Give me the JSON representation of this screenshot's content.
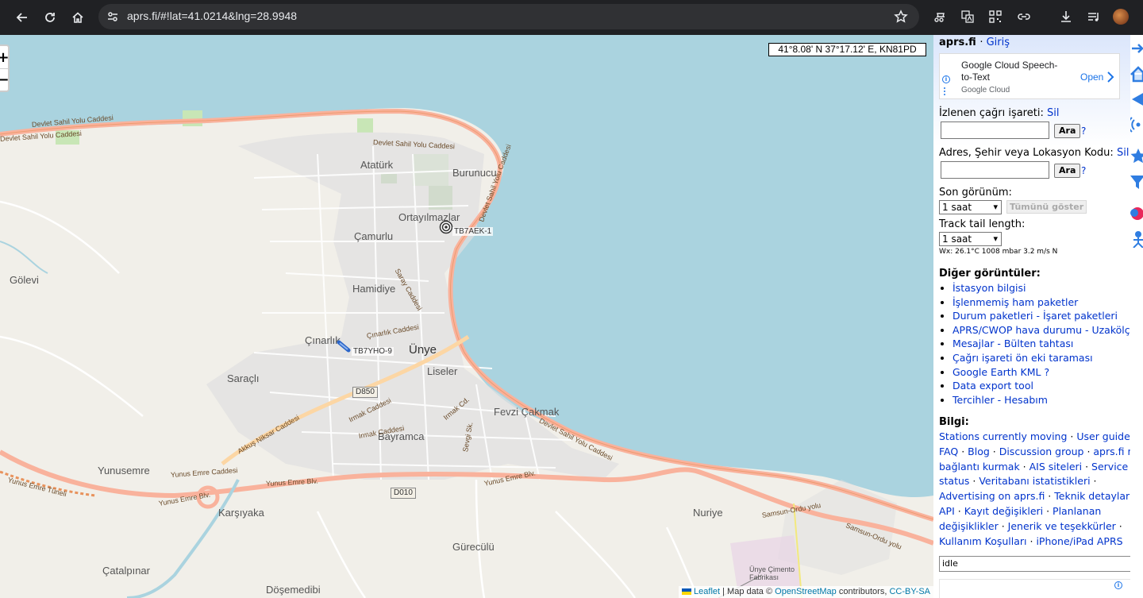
{
  "browser": {
    "url": "aprs.fi/#!lat=41.0214&lng=28.9948"
  },
  "map": {
    "zoom_in": "+",
    "zoom_out": "−",
    "coordinates": "41°8.08' N 37°17.12' E, KN81PD",
    "attribution": {
      "leaflet": "Leaflet",
      "sep": " | Map data © ",
      "osm": "OpenStreetMap",
      "contributors": " contributors, ",
      "license": "CC-BY-SA"
    },
    "places": [
      "Atatürk",
      "Burunucu",
      "Ortayılmazlar",
      "Çamurlu",
      "Gölevi",
      "Hamidiye",
      "Çınarlık",
      "Ünye",
      "Liseler",
      "Saraçlı",
      "Fevzi Çakmak",
      "Bayramca",
      "Yunusemre",
      "Nuriye",
      "Karşıyaka",
      "Gürecülü",
      "Çatalpınar",
      "Döşemedibi",
      "Ünye Çimento Fabrikası"
    ],
    "roads": [
      "Devlet Sahil Yolu Caddesi",
      "Devlet Sahil Yolu Caddesi",
      "Devlet Sahil Yolu Caddesi",
      "Devlet Sahil Yolu Caddesi",
      "Devlet Sahil Yolu Caddesi",
      "Yunus Emre Blv.",
      "Yunus Emre Blv.",
      "Yunus Emre Blv.",
      "Yunus Emre Tüneli",
      "Yunus Emre Caddesi",
      "Akkuş Niksar Caddesi",
      "Irmak Caddesi",
      "Irmak Caddesi",
      "Samsun-Ordu yolu",
      "Samsun-Ordu yolu",
      "Saray Caddesi",
      "Çınarlık Caddesi",
      "Sevgi Sk.",
      "Irmak Cd."
    ],
    "shields": [
      "D850",
      "D010"
    ],
    "stations": [
      "TB7AEK-1",
      "TB7YHO-9"
    ]
  },
  "panel": {
    "site": "aprs.fi",
    "login": "Giriş",
    "ad": {
      "title": "Google Cloud Speech-to-Text",
      "advertiser": "Google Cloud",
      "cta": "Open",
      "info": "i"
    },
    "tracked_label": "İzlenen çağrı işareti:",
    "tracked_clear": "Sil",
    "address_label": "Adres, Şehir veya Lokasyon Kodu:",
    "address_clear": "Sil",
    "search_btn": "Ara",
    "help": "?",
    "last_seen_label": "Son görünüm:",
    "last_seen_value": "1 saat",
    "show_all": "Tümünü göster",
    "tail_label": "Track tail length:",
    "tail_value": "1 saat",
    "wx": "Wx: 26.1°C 1008 mbar 3.2 m/s N",
    "other_views_title": "Diğer görüntüler:",
    "other_views": [
      "İstasyon bilgisi",
      "İşlenmemiş ham paketler",
      "Durum paketleri - İşaret paketleri",
      "APRS/CWOP hava durumu - Uzakölçüm",
      "Mesajlar - Bülten tahtası",
      "Çağrı işareti ön eki taraması",
      "Google Earth KML ?",
      "Data export tool",
      "Tercihler - Hesabım"
    ],
    "info_title": "Bilgi:",
    "info_links": [
      "Stations currently moving",
      "User guide",
      "FAQ",
      "Blog",
      "Discussion group",
      "aprs.fi na bağlantı kurmak",
      "AIS siteleri",
      "Service status",
      "Veritabanı istatistikleri",
      "Advertising on aprs.fi",
      "Teknik detaylar",
      "API",
      "Kayıt değişikleri",
      "Planlanan değişiklikler",
      "Jenerik ve teşekkürler",
      "Kullanım Koşulları",
      "iPhone/iPad APRS"
    ],
    "status_value": "idle"
  }
}
